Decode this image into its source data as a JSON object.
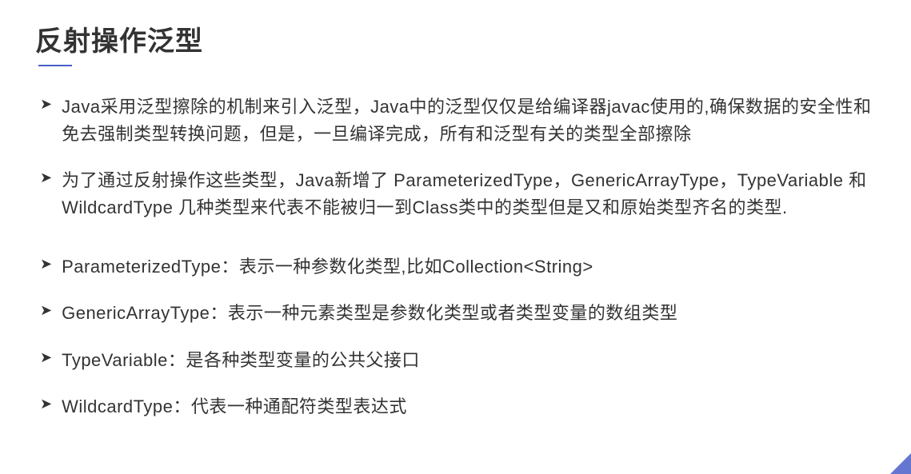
{
  "title": "反射操作泛型",
  "bullets": [
    {
      "text": "Java采用泛型擦除的机制来引入泛型，Java中的泛型仅仅是给编译器javac使用的,确保数据的安全性和免去强制类型转换问题，但是，一旦编译完成，所有和泛型有关的类型全部擦除"
    },
    {
      "text": "为了通过反射操作这些类型，Java新增了 ParameterizedType，GenericArrayType，TypeVariable 和 WildcardType 几种类型来代表不能被归一到Class类中的类型但是又和原始类型齐名的类型."
    },
    {
      "text": "ParameterizedType：表示一种参数化类型,比如Collection<String>"
    },
    {
      "text": "GenericArrayType：表示一种元素类型是参数化类型或者类型变量的数组类型"
    },
    {
      "text": "TypeVariable：是各种类型变量的公共父接口"
    },
    {
      "text": "WildcardType：代表一种通配符类型表达式"
    }
  ]
}
